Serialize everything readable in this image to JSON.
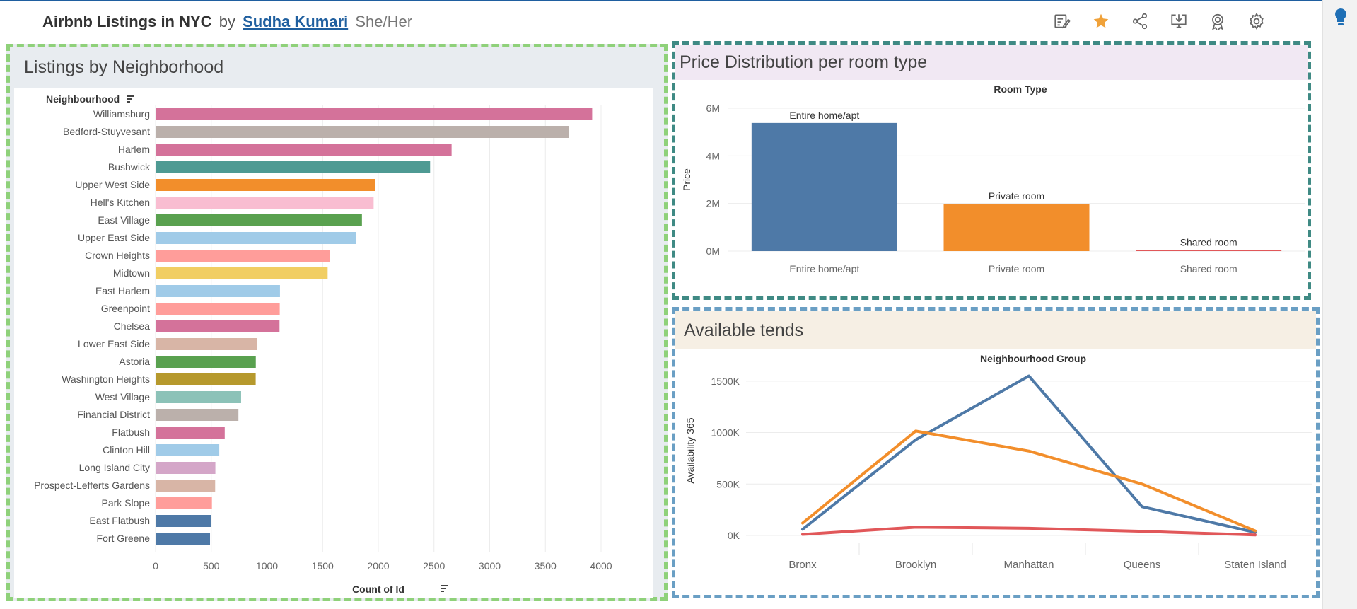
{
  "header": {
    "title": "Airbnb Listings in NYC",
    "by": "by",
    "author": "Sudha Kumari",
    "pronouns": "She/Her",
    "icons": [
      "edit-icon",
      "star-icon",
      "share-icon",
      "download-icon",
      "badge-icon",
      "settings-icon"
    ],
    "star_color": "#f0a23a"
  },
  "panels": {
    "left_title": "Listings by Neighborhood",
    "right_top_title": "Price Distribution per room type",
    "right_bottom_title": "Available tends"
  },
  "chart_data": [
    {
      "type": "bar",
      "orientation": "horizontal",
      "categories": [
        "Williamsburg",
        "Bedford-Stuyvesant",
        "Harlem",
        "Bushwick",
        "Upper West Side",
        "Hell's Kitchen",
        "East Village",
        "Upper East Side",
        "Crown Heights",
        "Midtown",
        "East Harlem",
        "Greenpoint",
        "Chelsea",
        "Lower East Side",
        "Astoria",
        "Washington Heights",
        "West Village",
        "Financial District",
        "Flatbush",
        "Clinton Hill",
        "Long Island City",
        "Prospect-Lefferts Gardens",
        "Park Slope",
        "East Flatbush",
        "Fort Greene"
      ],
      "values": [
        3920,
        3714,
        2658,
        2465,
        1971,
        1958,
        1853,
        1798,
        1564,
        1545,
        1117,
        1115,
        1113,
        912,
        900,
        899,
        768,
        744,
        621,
        572,
        537,
        535,
        506,
        500,
        489
      ],
      "colors": [
        "#d4729a",
        "#bbb0ab",
        "#d4729a",
        "#4e9a93",
        "#f28e2b",
        "#f9bdd1",
        "#59a14f",
        "#a0cbe8",
        "#ff9d9a",
        "#f1ce63",
        "#a0cbe8",
        "#ff9d9a",
        "#d4729a",
        "#d8b5a6",
        "#59a14f",
        "#b6992d",
        "#8cc2b8",
        "#bbb0ab",
        "#d4729a",
        "#a0cbe8",
        "#d4a6c8",
        "#d8b5a6",
        "#ff9d9a",
        "#4e79a7",
        "#4e79a7"
      ],
      "ylabel": "Neighbourhood",
      "xlabel": "Count of Id",
      "xlim": [
        0,
        4000
      ],
      "xticks": [
        0,
        500,
        1000,
        1500,
        2000,
        2500,
        3000,
        3500,
        4000
      ],
      "grid": true
    },
    {
      "type": "bar",
      "title": "Room Type",
      "categories": [
        "Entire home/apt",
        "Private room",
        "Shared room"
      ],
      "values": [
        5380000,
        1990000,
        50000
      ],
      "colors": [
        "#4e79a7",
        "#f28e2b",
        "#e15759"
      ],
      "ylabel": "Price",
      "ylim": [
        0,
        6000000
      ],
      "yticks": [
        {
          "v": 0,
          "label": "0M"
        },
        {
          "v": 2000000,
          "label": "2M"
        },
        {
          "v": 4000000,
          "label": "4M"
        },
        {
          "v": 6000000,
          "label": "6M"
        }
      ],
      "grid": true
    },
    {
      "type": "line",
      "title": "Neighbourhood Group",
      "categories": [
        "Bronx",
        "Brooklyn",
        "Manhattan",
        "Queens",
        "Staten Island"
      ],
      "series": [
        {
          "values": [
            60000,
            930000,
            1550000,
            280000,
            30000
          ],
          "color": "#4e79a7"
        },
        {
          "values": [
            120000,
            1015000,
            820000,
            500000,
            45000
          ],
          "color": "#f28e2b"
        },
        {
          "values": [
            10000,
            80000,
            70000,
            40000,
            5000
          ],
          "color": "#e15759"
        }
      ],
      "ylabel": "Availability 365",
      "ylim": [
        0,
        1650000
      ],
      "yticks": [
        {
          "v": 0,
          "label": "0K"
        },
        {
          "v": 500000,
          "label": "500K"
        },
        {
          "v": 1000000,
          "label": "1000K"
        },
        {
          "v": 1500000,
          "label": "1500K"
        }
      ],
      "grid": true
    }
  ]
}
